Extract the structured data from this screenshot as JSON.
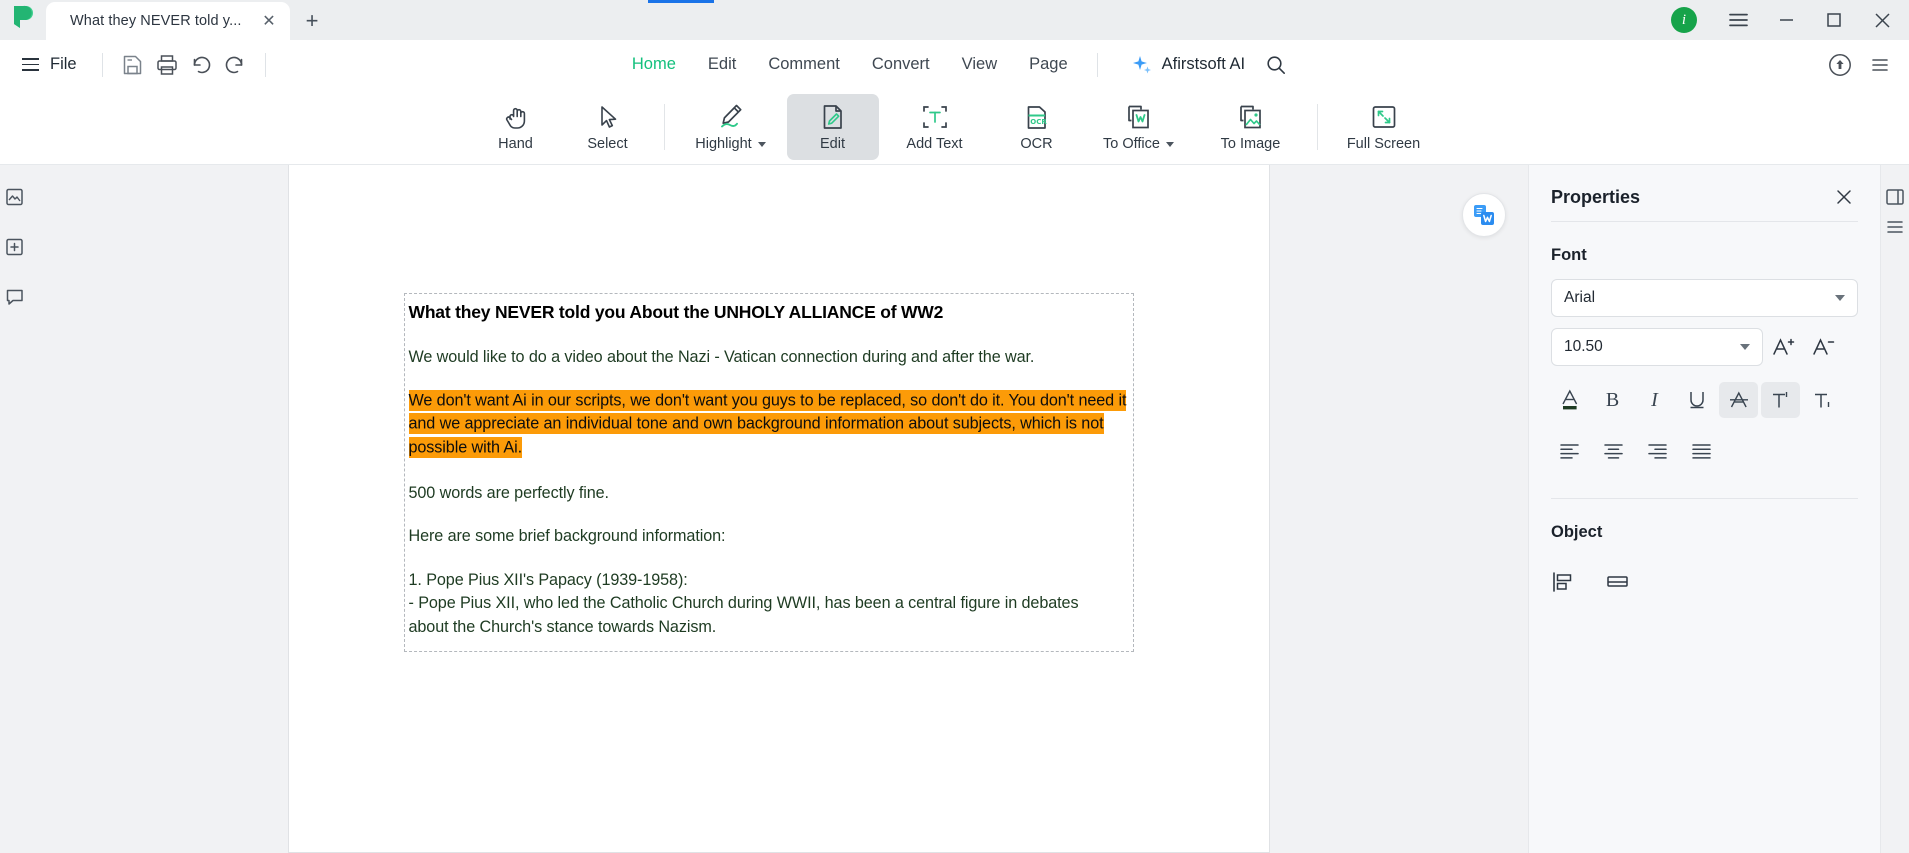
{
  "window": {
    "app_logo": "afirstsoft-logo",
    "info_badge": "i",
    "minimize": "─",
    "maximize": "□",
    "close": "✕"
  },
  "tabs": {
    "items": [
      {
        "title": "What they NEVER told y...",
        "close": "✕",
        "active": true
      }
    ],
    "new_tab": "+"
  },
  "menu": {
    "file_label": "File",
    "quick_icons": [
      "save-icon",
      "print-icon",
      "undo-icon",
      "redo-icon"
    ],
    "tabs": [
      {
        "label": "Home",
        "active": true
      },
      {
        "label": "Edit",
        "active": false
      },
      {
        "label": "Comment",
        "active": false
      },
      {
        "label": "Convert",
        "active": false
      },
      {
        "label": "View",
        "active": false
      },
      {
        "label": "Page",
        "active": false
      }
    ],
    "ai_label": "Afirstsoft AI",
    "search_icon": "search-icon",
    "cloud_icon": "cloud-upload-icon"
  },
  "ribbon": {
    "items": [
      {
        "label": "Hand",
        "icon": "hand-icon",
        "selected": false,
        "caret": false
      },
      {
        "label": "Select",
        "icon": "cursor-icon",
        "selected": false,
        "caret": false
      },
      {
        "label": "Highlight",
        "icon": "highlight-pen-icon",
        "selected": false,
        "caret": true
      },
      {
        "label": "Edit",
        "icon": "edit-document-icon",
        "selected": true,
        "caret": false
      },
      {
        "label": "Add Text",
        "icon": "add-text-icon",
        "selected": false,
        "caret": false
      },
      {
        "label": "OCR",
        "icon": "ocr-icon",
        "selected": false,
        "caret": false
      },
      {
        "label": "To Office",
        "icon": "to-office-word-icon",
        "selected": false,
        "caret": true
      },
      {
        "label": "To Image",
        "icon": "to-image-icon",
        "selected": false,
        "caret": false
      },
      {
        "label": "Full Screen",
        "icon": "full-screen-icon",
        "selected": false,
        "caret": false
      }
    ]
  },
  "left_rail": {
    "icons": [
      "thumbnails-icon",
      "add-page-icon",
      "comments-icon"
    ]
  },
  "document": {
    "convert_float_button": "word-convert-icon",
    "title": "What they NEVER told you About the UNHOLY ALLIANCE of WW2",
    "paragraphs": [
      {
        "text": "We would like to do a video about the Nazi - Vatican connection during and after the war.",
        "highlight": false
      },
      {
        "text": "We don't want Ai in our scripts, we don't want you guys to be replaced, so don't do it. You don't need it and we appreciate an individual tone and own background information about subjects, which is not possible with Ai.",
        "highlight": true
      },
      {
        "text": "500 words are perfectly fine.",
        "highlight": false
      },
      {
        "text": "Here are some brief background information:",
        "highlight": false
      }
    ],
    "list_lines": [
      "1. Pope Pius XII's Papacy (1939-1958):",
      "- Pope Pius XII, who led the Catholic Church during WWII, has been a central figure in debates",
      "about the Church's stance towards Nazism."
    ],
    "highlight_color": "#fc9b08",
    "body_text_color": "#1e3b22"
  },
  "properties": {
    "title": "Properties",
    "close_icon": "close-icon",
    "font_section": {
      "label": "Font",
      "family": "Arial",
      "size": "10.50",
      "increase_icon": "increase-font-size-icon",
      "decrease_icon": "decrease-font-size-icon",
      "format_buttons": [
        {
          "name": "font-color",
          "glyph": "A",
          "active": false
        },
        {
          "name": "bold",
          "glyph": "B",
          "active": false
        },
        {
          "name": "italic",
          "glyph": "I",
          "active": false
        },
        {
          "name": "underline",
          "glyph": "U",
          "active": false
        },
        {
          "name": "strikethrough",
          "glyph": "A",
          "active": true
        },
        {
          "name": "superscript",
          "glyph": "T",
          "active": true
        },
        {
          "name": "subscript",
          "glyph": "T",
          "active": false
        }
      ],
      "align_buttons": [
        "align-left",
        "align-center",
        "align-right",
        "align-justify"
      ],
      "font_color_swatch": "#1e3b22"
    },
    "object_section": {
      "label": "Object",
      "buttons": [
        "align-objects-icon",
        "distribute-objects-icon"
      ]
    }
  },
  "right_rail": {
    "icons": [
      "panel-toggle-icon",
      "more-icon"
    ]
  },
  "colors": {
    "accent_green": "#13c07d",
    "tab_accent_blue": "#1a73e8",
    "highlight_orange": "#fc9b08",
    "chrome_gray": "#eceef0",
    "panel_bg": "#f7f8fa"
  }
}
